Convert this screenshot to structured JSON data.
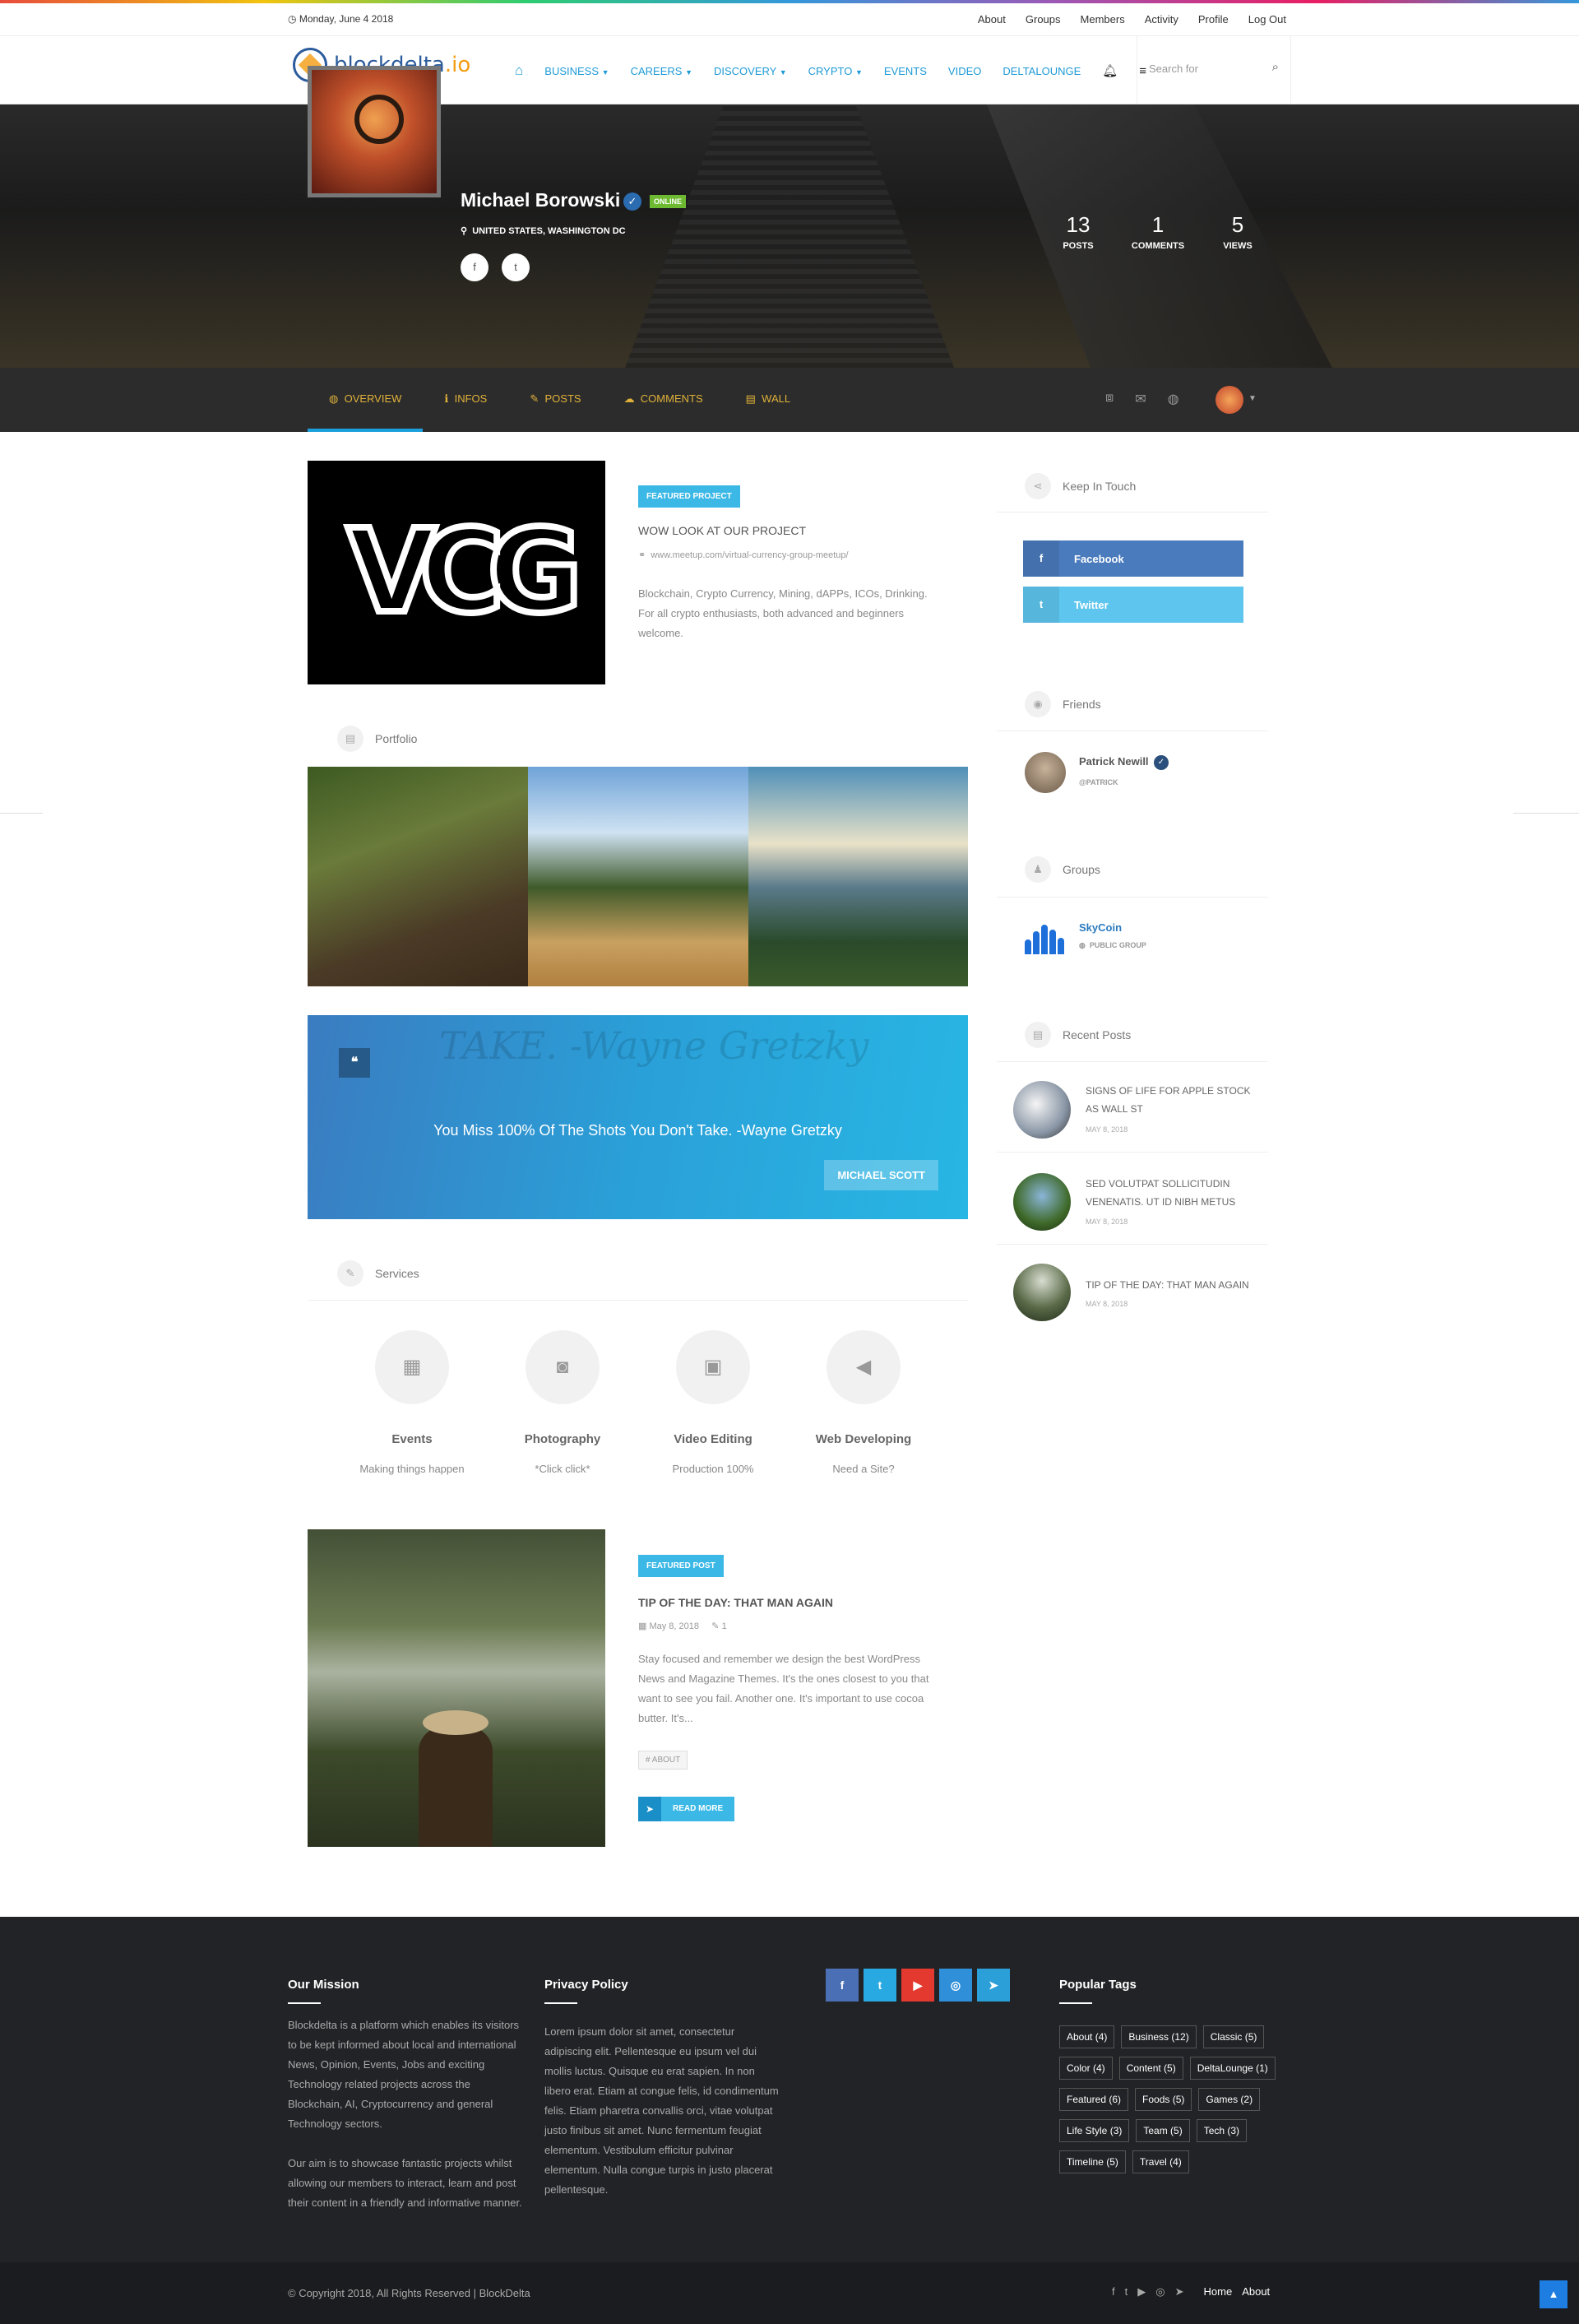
{
  "topbar": {
    "date": "Monday, June 4 2018",
    "links": [
      "About",
      "Groups",
      "Members",
      "Activity",
      "Profile",
      "Log Out"
    ]
  },
  "header": {
    "logo_main": "blockdelta",
    "logo_suffix": ".io",
    "nav": [
      "BUSINESS",
      "CAREERS",
      "DISCOVERY",
      "CRYPTO",
      "EVENTS",
      "VIDEO",
      "DELTALOUNGE"
    ],
    "search_placeholder": "Search for"
  },
  "profile": {
    "name": "Michael Borowski",
    "status": "ONLINE",
    "location": "UNITED STATES, WASHINGTON DC",
    "stats": [
      {
        "value": "13",
        "label": "POSTS"
      },
      {
        "value": "1",
        "label": "COMMENTS"
      },
      {
        "value": "5",
        "label": "VIEWS"
      }
    ]
  },
  "profile_nav": {
    "tabs": [
      "OVERVIEW",
      "INFOS",
      "POSTS",
      "COMMENTS",
      "WALL"
    ],
    "active_tab": "OVERVIEW"
  },
  "featured": {
    "badge": "FEATURED PROJECT",
    "title": "WOW LOOK AT OUR PROJECT",
    "link": "www.meetup.com/virtual-currency-group-meetup/",
    "description": "Blockchain, Crypto Currency, Mining, dAPPs, ICOs, Drinking. For all crypto enthusiasts, both advanced and beginners welcome.",
    "image_text": "VCG"
  },
  "portfolio": {
    "heading": "Portfolio"
  },
  "quote": {
    "text": "You Miss 100% Of The Shots You Don't Take. -Wayne Gretzky",
    "author": "MICHAEL SCOTT",
    "background_text": "TAKE. -Wayne Gretzky"
  },
  "services": {
    "heading": "Services",
    "items": [
      {
        "title": "Events",
        "subtitle": "Making things happen",
        "icon": "calendar-icon"
      },
      {
        "title": "Photography",
        "subtitle": "*Click click*",
        "icon": "camera-icon"
      },
      {
        "title": "Video Editing",
        "subtitle": "Production 100%",
        "icon": "video-file-icon"
      },
      {
        "title": "Web Developing",
        "subtitle": "Need a Site?",
        "icon": "megaphone-icon"
      }
    ]
  },
  "featured_post": {
    "badge": "FEATURED POST",
    "title": "TIP OF THE DAY: THAT MAN AGAIN",
    "date": "May 8, 2018",
    "comments": "1",
    "excerpt": "Stay focused and remember we design the best WordPress News and Magazine Themes. It's the ones closest to you that want to see you fail. Another one. It's important to use cocoa butter. It's...",
    "tag": "# ABOUT",
    "read_more": "READ MORE"
  },
  "sidebar": {
    "keep_in_touch": "Keep In Touch",
    "facebook": "Facebook",
    "twitter": "Twitter",
    "friends_heading": "Friends",
    "friend_name": "Patrick Newill",
    "friend_handle": "@PATRICK",
    "groups_heading": "Groups",
    "group_name": "SkyCoin",
    "group_type": "PUBLIC GROUP",
    "recent_heading": "Recent Posts",
    "recent_posts": [
      {
        "title": "SIGNS OF LIFE FOR APPLE STOCK AS WALL ST",
        "date": "MAY 8, 2018"
      },
      {
        "title": "SED VOLUTPAT SOLLICITUDIN VENENATIS. UT ID NIBH METUS",
        "date": "MAY 8, 2018"
      },
      {
        "title": "TIP OF THE DAY: THAT MAN AGAIN",
        "date": "MAY 8, 2018"
      }
    ]
  },
  "footer": {
    "mission_heading": "Our Mission",
    "mission_p1": "Blockdelta is a platform which enables its visitors to be kept informed about local and international  News, Opinion, Events, Jobs and exciting Technology related projects across the Blockchain, AI, Cryptocurrency and general Technology sectors.",
    "mission_p2": "Our aim is to showcase fantastic projects whilst allowing our members to interact, learn and post their content in a friendly and informative manner.",
    "privacy_heading": "Privacy Policy",
    "privacy_text": "Lorem ipsum dolor sit amet, consectetur adipiscing elit. Pellentesque eu ipsum vel dui mollis luctus. Quisque eu erat sapien. In non libero erat. Etiam at congue felis, id condimentum felis. Etiam pharetra convallis orci, vitae volutpat justo finibus sit amet. Nunc fermentum feugiat elementum. Vestibulum efficitur pulvinar elementum. Nulla congue turpis in justo placerat pellentesque.",
    "tags_heading": "Popular Tags",
    "tags": [
      "About (4)",
      "Business (12)",
      "Classic (5)",
      "Color (4)",
      "Content (5)",
      "DeltaLounge (1)",
      "Featured (6)",
      "Foods (5)",
      "Games (2)",
      "Life Style (3)",
      "Team (5)",
      "Tech (3)",
      "Timeline (5)",
      "Travel (4)"
    ],
    "social": [
      {
        "name": "facebook-icon",
        "color": "#4a6fb5",
        "glyph": "f"
      },
      {
        "name": "twitter-icon",
        "color": "#29a9e1",
        "glyph": "t"
      },
      {
        "name": "youtube-icon",
        "color": "#e3392e",
        "glyph": "▶"
      },
      {
        "name": "instagram-icon",
        "color": "#2f8fd8",
        "glyph": "◎"
      },
      {
        "name": "telegram-icon",
        "color": "#2a9fd8",
        "glyph": "➤"
      }
    ],
    "copyright": "© Copyright 2018, All Rights Reserved  |  BlockDelta",
    "bottom_links": [
      "Home",
      "About"
    ]
  }
}
